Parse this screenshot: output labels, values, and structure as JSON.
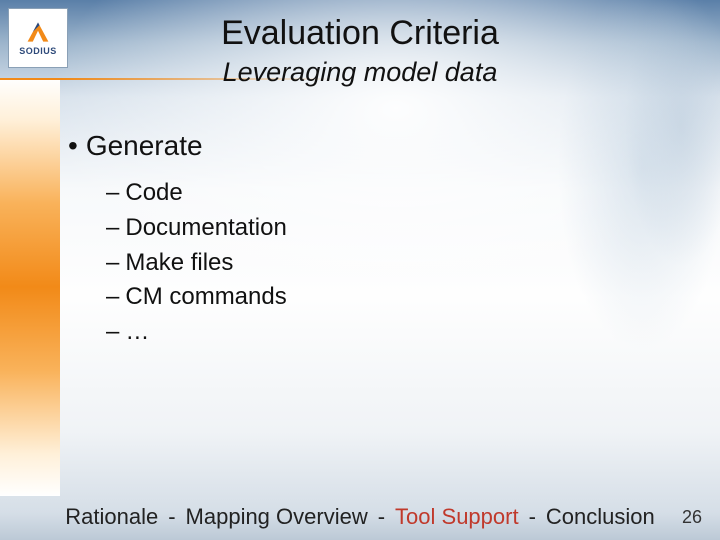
{
  "logo": {
    "text": "SODIUS"
  },
  "title": "Evaluation Criteria",
  "subtitle": "Leveraging model data",
  "bullet": {
    "label": "Generate",
    "items": [
      "Code",
      "Documentation",
      "Make files",
      "CM commands",
      "…"
    ]
  },
  "footer": {
    "crumbs": [
      "Rationale",
      "Mapping Overview",
      "Tool Support",
      "Conclusion"
    ],
    "active_index": 2,
    "separator": "-"
  },
  "page_number": "26"
}
